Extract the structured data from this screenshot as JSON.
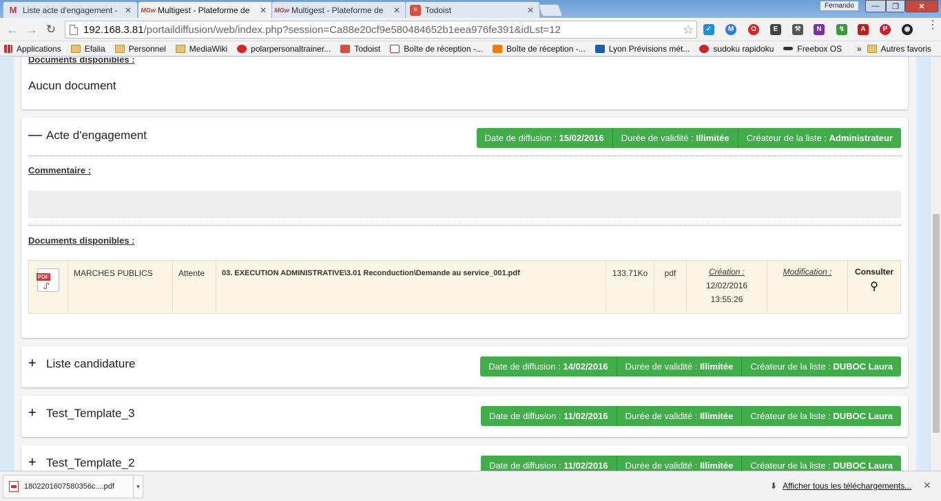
{
  "browser": {
    "tabs": [
      {
        "title": "Liste acte d'engagement -",
        "favicon": "gmail-icon",
        "active": false
      },
      {
        "title": "Multigest - Plateforme de",
        "favicon": "multigest-icon",
        "active": true
      },
      {
        "title": "Multigest - Plateforme de",
        "favicon": "multigest-icon",
        "active": false
      },
      {
        "title": "Todoist",
        "favicon": "todoist-icon",
        "active": false
      }
    ],
    "profile": "Fernando",
    "address": {
      "host": "192.168.3.81",
      "path": "/portaildiffusion/web/index.php?session=Ca88e20cf9e580484652b1eea976fe391&idLst=12"
    },
    "bookmarks": [
      {
        "label": "Applications",
        "icon": "apps-icon"
      },
      {
        "label": "Efalia",
        "icon": "folder-icon"
      },
      {
        "label": "Personnel",
        "icon": "folder-icon"
      },
      {
        "label": "MediaWiki",
        "icon": "folder-icon"
      },
      {
        "label": "polarpersonaltrainer...",
        "icon": "polar-icon"
      },
      {
        "label": "Todoist",
        "icon": "todoist-icon"
      },
      {
        "label": "Boîte de réception -...",
        "icon": "gmail-icon"
      },
      {
        "label": "Boîte de réception -...",
        "icon": "orange-icon"
      },
      {
        "label": "Lyon Prévisions mét...",
        "icon": "weather-icon"
      },
      {
        "label": "sudoku rapidoku",
        "icon": "sudoku-icon"
      },
      {
        "label": "Freebox OS",
        "icon": "freebox-icon"
      }
    ],
    "bookmarks_more": "»",
    "bookmarks_other": "Autres favoris"
  },
  "page": {
    "top_panel": {
      "label": "Documents disponibles :",
      "empty": "Aucun document"
    },
    "acte": {
      "toggle": "—",
      "title": "Acte d'engagement",
      "badges": [
        {
          "label": "Date de diffusion : ",
          "value": "15/02/2016"
        },
        {
          "label": "Durée de validité : ",
          "value": "Illimitée"
        },
        {
          "label": "Créateur de la liste : ",
          "value": "Administrateur"
        }
      ],
      "comment_label": "Commentaire :",
      "docs_label": "Documents disponibles :",
      "document": {
        "type_icon": "pdf-file-icon",
        "category": "MARCHES PUBLICS",
        "status": "Attente",
        "path": "03. EXECUTION ADMINISTRATIVE\\3.01 Reconduction\\Demande au service_001.pdf",
        "size": "133.71Ko",
        "ext": "pdf",
        "creation_label": "Création :",
        "creation_date": "12/02/2016",
        "creation_time": "13:55:26",
        "modification_label": "Modification :",
        "consult_label": "Consulter"
      }
    },
    "lists": [
      {
        "toggle": "+",
        "title": "Liste candidature",
        "badges": [
          {
            "label": "Date de diffusion : ",
            "value": "14/02/2016"
          },
          {
            "label": "Durée de validité : ",
            "value": "Illimitée"
          },
          {
            "label": "Créateur de la liste : ",
            "value": "DUBOC Laura"
          }
        ]
      },
      {
        "toggle": "+",
        "title": "Test_Template_3",
        "badges": [
          {
            "label": "Date de diffusion : ",
            "value": "11/02/2016"
          },
          {
            "label": "Durée de validité : ",
            "value": "Illimitée"
          },
          {
            "label": "Créateur de la liste : ",
            "value": "DUBOC Laura"
          }
        ]
      },
      {
        "toggle": "+",
        "title": "Test_Template_2",
        "badges": [
          {
            "label": "Date de diffusion : ",
            "value": "11/02/2016"
          },
          {
            "label": "Durée de validité : ",
            "value": "Illimitée"
          },
          {
            "label": "Créateur de la liste : ",
            "value": "DUBOC Laura"
          }
        ]
      }
    ]
  },
  "downloads": {
    "file": "1802201607580356c....pdf",
    "show_all": "Afficher tous les téléchargements..."
  },
  "colors": {
    "badge_green": "#3fae49",
    "doc_row_bg": "#fbf6e3"
  }
}
